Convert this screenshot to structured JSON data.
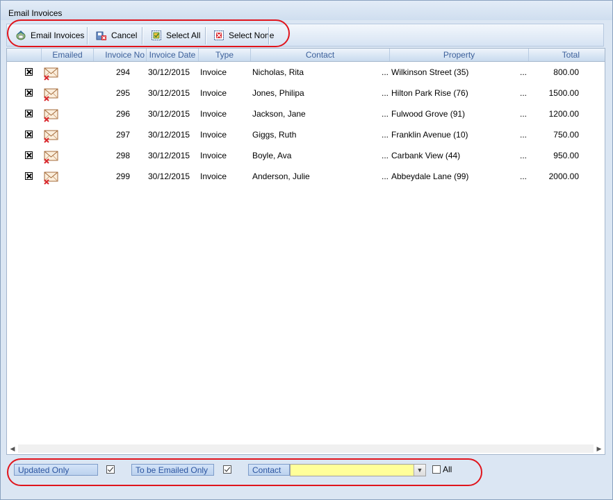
{
  "window": {
    "title": "Email Invoices"
  },
  "toolbar": {
    "email_invoices_label": "Email Invoices",
    "cancel_label": "Cancel",
    "select_all_label": "Select All",
    "select_none_label": "Select None"
  },
  "grid": {
    "columns": [
      "Emailed",
      "Invoice No",
      "Invoice Date",
      "Type",
      "Contact",
      "Property",
      "Total"
    ],
    "ellipsis": "...",
    "rows": [
      {
        "invoice_no": "294",
        "date": "30/12/2015",
        "type": "Invoice",
        "contact": "Nicholas, Rita",
        "property": "Wilkinson Street (35)",
        "total": "800.00"
      },
      {
        "invoice_no": "295",
        "date": "30/12/2015",
        "type": "Invoice",
        "contact": "Jones, Philipa",
        "property": "Hilton Park Rise (76)",
        "total": "1500.00"
      },
      {
        "invoice_no": "296",
        "date": "30/12/2015",
        "type": "Invoice",
        "contact": "Jackson, Jane",
        "property": "Fulwood Grove (91)",
        "total": "1200.00"
      },
      {
        "invoice_no": "297",
        "date": "30/12/2015",
        "type": "Invoice",
        "contact": "Giggs, Ruth",
        "property": "Franklin Avenue (10)",
        "total": "750.00"
      },
      {
        "invoice_no": "298",
        "date": "30/12/2015",
        "type": "Invoice",
        "contact": "Boyle, Ava",
        "property": "Carbank View (44)",
        "total": "950.00"
      },
      {
        "invoice_no": "299",
        "date": "30/12/2015",
        "type": "Invoice",
        "contact": "Anderson, Julie",
        "property": "Abbeydale Lane (99)",
        "total": "2000.00"
      }
    ]
  },
  "filters": {
    "updated_only_label": "Updated Only",
    "updated_only_checked": true,
    "to_be_emailed_only_label": "To be Emailed Only",
    "to_be_emailed_only_checked": true,
    "contact_label": "Contact",
    "contact_value": "",
    "all_label": "All",
    "all_checked": false
  },
  "colors": {
    "highlight": "#e0141c",
    "combo_bg": "#ffff99",
    "header_text": "#3b5f9a"
  }
}
